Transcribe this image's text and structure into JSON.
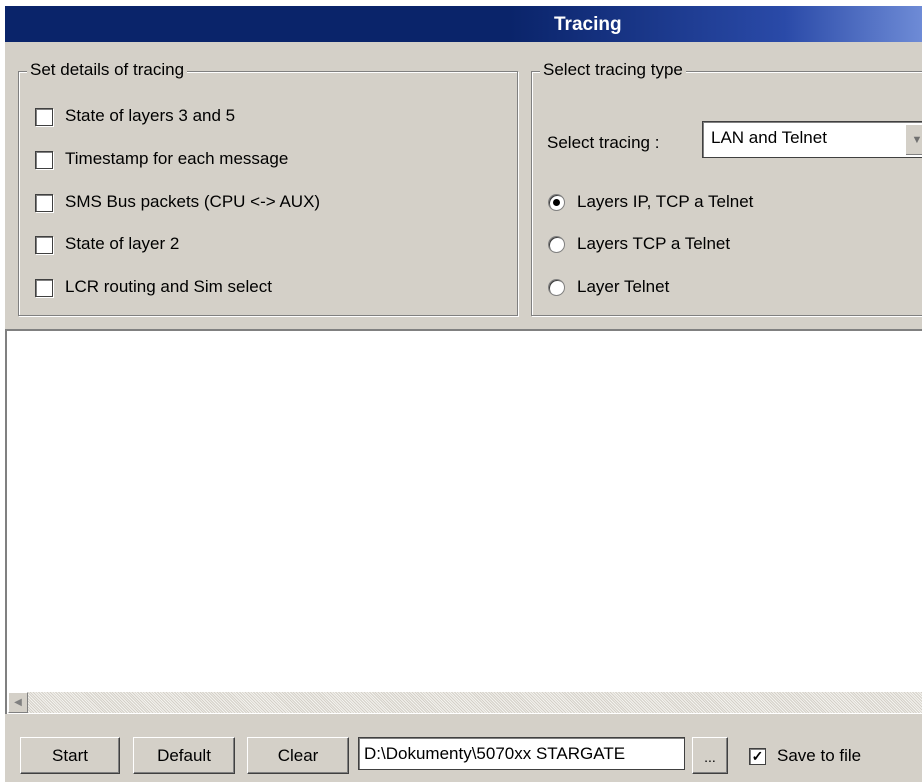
{
  "window": {
    "title": "Tracing"
  },
  "details": {
    "legend": "Set details of tracing",
    "options": [
      {
        "label": "State of layers 3 and 5",
        "checked": false
      },
      {
        "label": "Timestamp for each message",
        "checked": false
      },
      {
        "label": "SMS Bus packets (CPU <-> AUX)",
        "checked": false
      },
      {
        "label": "State of layer 2",
        "checked": false
      },
      {
        "label": "LCR routing and Sim select",
        "checked": false
      }
    ]
  },
  "tracing_type": {
    "legend": "Select tracing type",
    "select_label": "Select tracing :",
    "select_value": "LAN and Telnet",
    "radios": [
      {
        "label": "Layers IP, TCP a Telnet",
        "selected": true
      },
      {
        "label": "Layers TCP a Telnet",
        "selected": false
      },
      {
        "label": "Layer Telnet",
        "selected": false
      }
    ]
  },
  "log": {
    "content": ""
  },
  "bottom": {
    "start_label": "Start",
    "default_label": "Default",
    "clear_label": "Clear",
    "file_path": "D:\\Dokumenty\\5070xx STARGATE",
    "browse_label": "...",
    "save_to_file_label": "Save to file",
    "save_to_file_checked": true
  }
}
